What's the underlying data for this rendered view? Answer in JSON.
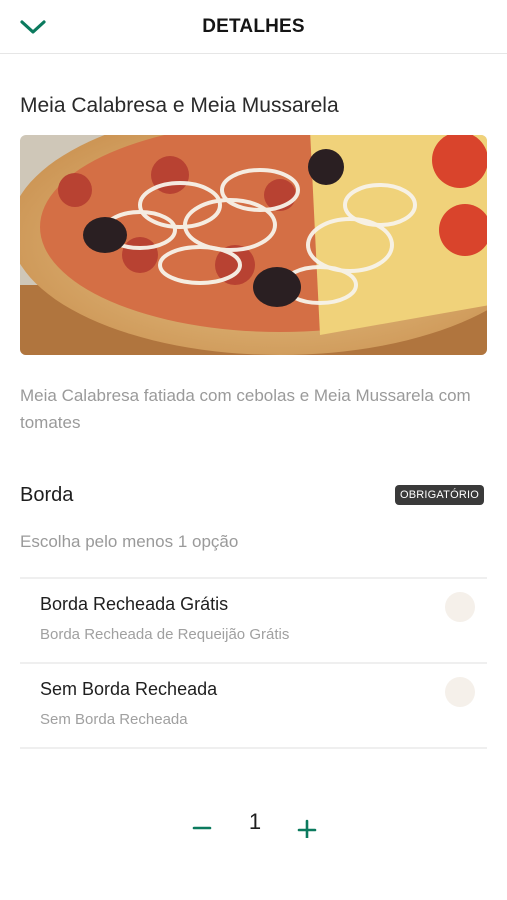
{
  "header": {
    "title": "DETALHES",
    "back_icon": "chevron-down-icon"
  },
  "product": {
    "title": "Meia Calabresa e Meia Mussarela",
    "description": "Meia Calabresa fatiada com cebolas e Meia Mussarela com tomates"
  },
  "group": {
    "title": "Borda",
    "badge": "OBRIGATÓRIO",
    "subtitle": "Escolha pelo menos 1 opção",
    "options": [
      {
        "name": "Borda Recheada Grátis",
        "description": "Borda Recheada de Requeijão Grátis",
        "selected": false
      },
      {
        "name": "Sem Borda Recheada",
        "description": "Sem Borda Recheada",
        "selected": false
      }
    ]
  },
  "quantity": {
    "value": "1",
    "minus_icon": "minus-icon",
    "plus_icon": "plus-icon"
  },
  "colors": {
    "accent": "#0b7a5e",
    "badge_bg": "#3a3a3a",
    "radio_bg": "#f5f0ea"
  }
}
